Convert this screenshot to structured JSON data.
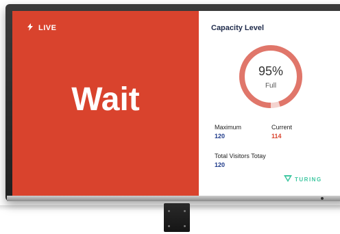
{
  "status": {
    "live_label": "LIVE",
    "message": "Wait"
  },
  "capacity": {
    "title": "Capacity Level",
    "percent": 95,
    "percent_label": "95%",
    "state_label": "Full",
    "maximum_label": "Maximum",
    "maximum_value": "120",
    "current_label": "Current",
    "current_value": "114",
    "total_label": "Total Visitors Totay",
    "total_value": "120"
  },
  "brand": {
    "name": "TURING"
  },
  "colors": {
    "accent": "#d9432d",
    "ring": "#e0766a",
    "ring_track": "#f4d3cf",
    "title": "#1e2a4a",
    "brand": "#3ec7a1",
    "value_blue": "#1e3a8a",
    "value_red": "#d9432d"
  },
  "icons": {
    "live": "lightning-bolt-icon",
    "brand": "turing-logo-icon"
  }
}
